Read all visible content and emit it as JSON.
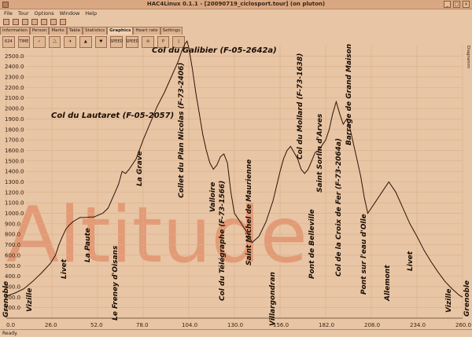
{
  "window": {
    "title": "HAC4Linux 0.1.1 - [20090719_ciclosport.tour] (on pluton)"
  },
  "menu": [
    "File",
    "Tour",
    "Options",
    "Window",
    "Help"
  ],
  "tabs": [
    "Information",
    "Person",
    "Marks",
    "Table",
    "Statistics",
    "Graphics",
    "Heart rate",
    "Settings"
  ],
  "active_tab": "Graphics",
  "toolbar2": [
    "624",
    "TIME",
    "",
    "",
    "",
    "",
    "SPEED",
    "SPEED"
  ],
  "side_label": "Diagramm",
  "status": "Ready.",
  "watermark": "Altitude",
  "chart_data": {
    "type": "area",
    "xlim": [
      0,
      260
    ],
    "ylim": [
      0,
      2600
    ],
    "x_ticks": [
      0.0,
      26.0,
      52.0,
      78.0,
      104.0,
      130.0,
      156.0,
      182.0,
      208.0,
      234.0,
      260.0
    ],
    "x_tick_labels": [
      "0.0",
      "26.0",
      "52.0",
      "78.0",
      "104.0",
      "130.0",
      "156.0",
      "182.0",
      "208.0",
      "234.0",
      "260.0"
    ],
    "y_ticks": [
      100,
      200,
      300,
      400,
      500,
      600,
      700,
      800,
      900,
      1000,
      1100,
      1200,
      1300,
      1400,
      1500,
      1600,
      1700,
      1800,
      1900,
      2000,
      2100,
      2200,
      2300,
      2400,
      2500
    ],
    "y_tick_labels": [
      "100.0",
      "200.0",
      "300.0",
      "400.0",
      "500.0",
      "600.0",
      "700.0",
      "800.0",
      "900.0",
      "1000.0",
      "1100.0",
      "1200.0",
      "1300.0",
      "1400.0",
      "1500.0",
      "1600.0",
      "1700.0",
      "1800.0",
      "1900.0",
      "2000.0",
      "2100.0",
      "2200.0",
      "2300.0",
      "2400.0",
      "2500.0"
    ],
    "grid": true,
    "series": [
      {
        "x": [
          0,
          5,
          10,
          15,
          20,
          25,
          28,
          30,
          32,
          34,
          36,
          38,
          40,
          42,
          45,
          48,
          50,
          52,
          55,
          58,
          62,
          64,
          66,
          68,
          70,
          74,
          78,
          82,
          86,
          90,
          94,
          98,
          100,
          102,
          103,
          104,
          106,
          108,
          110,
          112,
          114,
          116,
          118,
          120,
          122,
          124,
          126,
          128,
          130,
          132,
          134,
          136,
          138,
          140,
          144,
          148,
          152,
          156,
          158,
          160,
          162,
          164,
          166,
          168,
          170,
          172,
          174,
          176,
          178,
          180,
          182,
          184,
          186,
          188,
          190,
          192,
          194,
          196,
          198,
          200,
          202,
          204,
          206,
          208,
          210,
          212,
          214,
          216,
          218,
          220,
          222,
          226,
          230,
          234,
          238,
          242,
          246,
          250,
          254,
          258,
          260
        ],
        "y": [
          210,
          240,
          280,
          350,
          430,
          520,
          600,
          700,
          780,
          850,
          890,
          920,
          940,
          960,
          960,
          965,
          965,
          980,
          1000,
          1050,
          1200,
          1280,
          1400,
          1380,
          1420,
          1520,
          1700,
          1860,
          2020,
          2150,
          2300,
          2450,
          2550,
          2620,
          2642,
          2580,
          2380,
          2150,
          1950,
          1750,
          1600,
          1480,
          1420,
          1460,
          1540,
          1566,
          1480,
          1200,
          1000,
          950,
          900,
          850,
          800,
          720,
          780,
          920,
          1120,
          1400,
          1520,
          1600,
          1638,
          1580,
          1520,
          1420,
          1380,
          1420,
          1500,
          1580,
          1600,
          1650,
          1700,
          1800,
          1950,
          2064,
          1950,
          1850,
          1900,
          1800,
          1650,
          1500,
          1350,
          1150,
          1000,
          1050,
          1100,
          1150,
          1200,
          1250,
          1300,
          1250,
          1200,
          1050,
          900,
          780,
          650,
          540,
          440,
          350,
          280,
          220,
          200
        ]
      }
    ],
    "annotations": [
      {
        "text": "Grenoble",
        "x": 0,
        "vertical": true
      },
      {
        "text": "Vizille",
        "x": 7,
        "vertical": true
      },
      {
        "text": "Livet",
        "x": 18,
        "vertical": true
      },
      {
        "text": "La Paute",
        "x": 28,
        "vertical": true
      },
      {
        "text": "Le Freney d'Oisans",
        "x": 42,
        "vertical": true
      },
      {
        "text": "La Grave",
        "x": 52,
        "vertical": true
      },
      {
        "text": "Col du Lautaret (F-05-2057)",
        "x": 60,
        "vertical": false
      },
      {
        "text": "Collet du Plan Nicolas (F-73-2406)",
        "x": 65,
        "vertical": true
      },
      {
        "text": "Col du Galibier (F-05-2642a)",
        "x": 103,
        "vertical": false
      },
      {
        "text": "Valloire",
        "x": 120,
        "vertical": true
      },
      {
        "text": "Col du Télégraphe (F-73-1566)",
        "x": 125,
        "vertical": true
      },
      {
        "text": "Saint Michel de Maurienne",
        "x": 133,
        "vertical": true
      },
      {
        "text": "Villargondran",
        "x": 145,
        "vertical": true
      },
      {
        "text": "Col du Mollard (F-73-1638)",
        "x": 152,
        "vertical": true
      },
      {
        "text": "Pont de Belleville",
        "x": 160,
        "vertical": true
      },
      {
        "text": "Saint Sorlin d'Arves",
        "x": 166,
        "vertical": true
      },
      {
        "text": "Col de la Croix de Fer (F-73-2064a)",
        "x": 176,
        "vertical": true
      },
      {
        "text": "Barrage de Grand Maison",
        "x": 184,
        "vertical": true
      },
      {
        "text": "Pont sur l'eau d'Olle",
        "x": 190,
        "vertical": true
      },
      {
        "text": "Allemont",
        "x": 200,
        "vertical": true
      },
      {
        "text": "Livet",
        "x": 215,
        "vertical": true
      },
      {
        "text": "Vizille",
        "x": 240,
        "vertical": true
      },
      {
        "text": "Grenoble",
        "x": 258,
        "vertical": true
      }
    ]
  },
  "colors": {
    "background": "#e8c5a4",
    "line": "#2b1408",
    "watermark": "#e29b76",
    "grid": "#d9ae8d"
  }
}
